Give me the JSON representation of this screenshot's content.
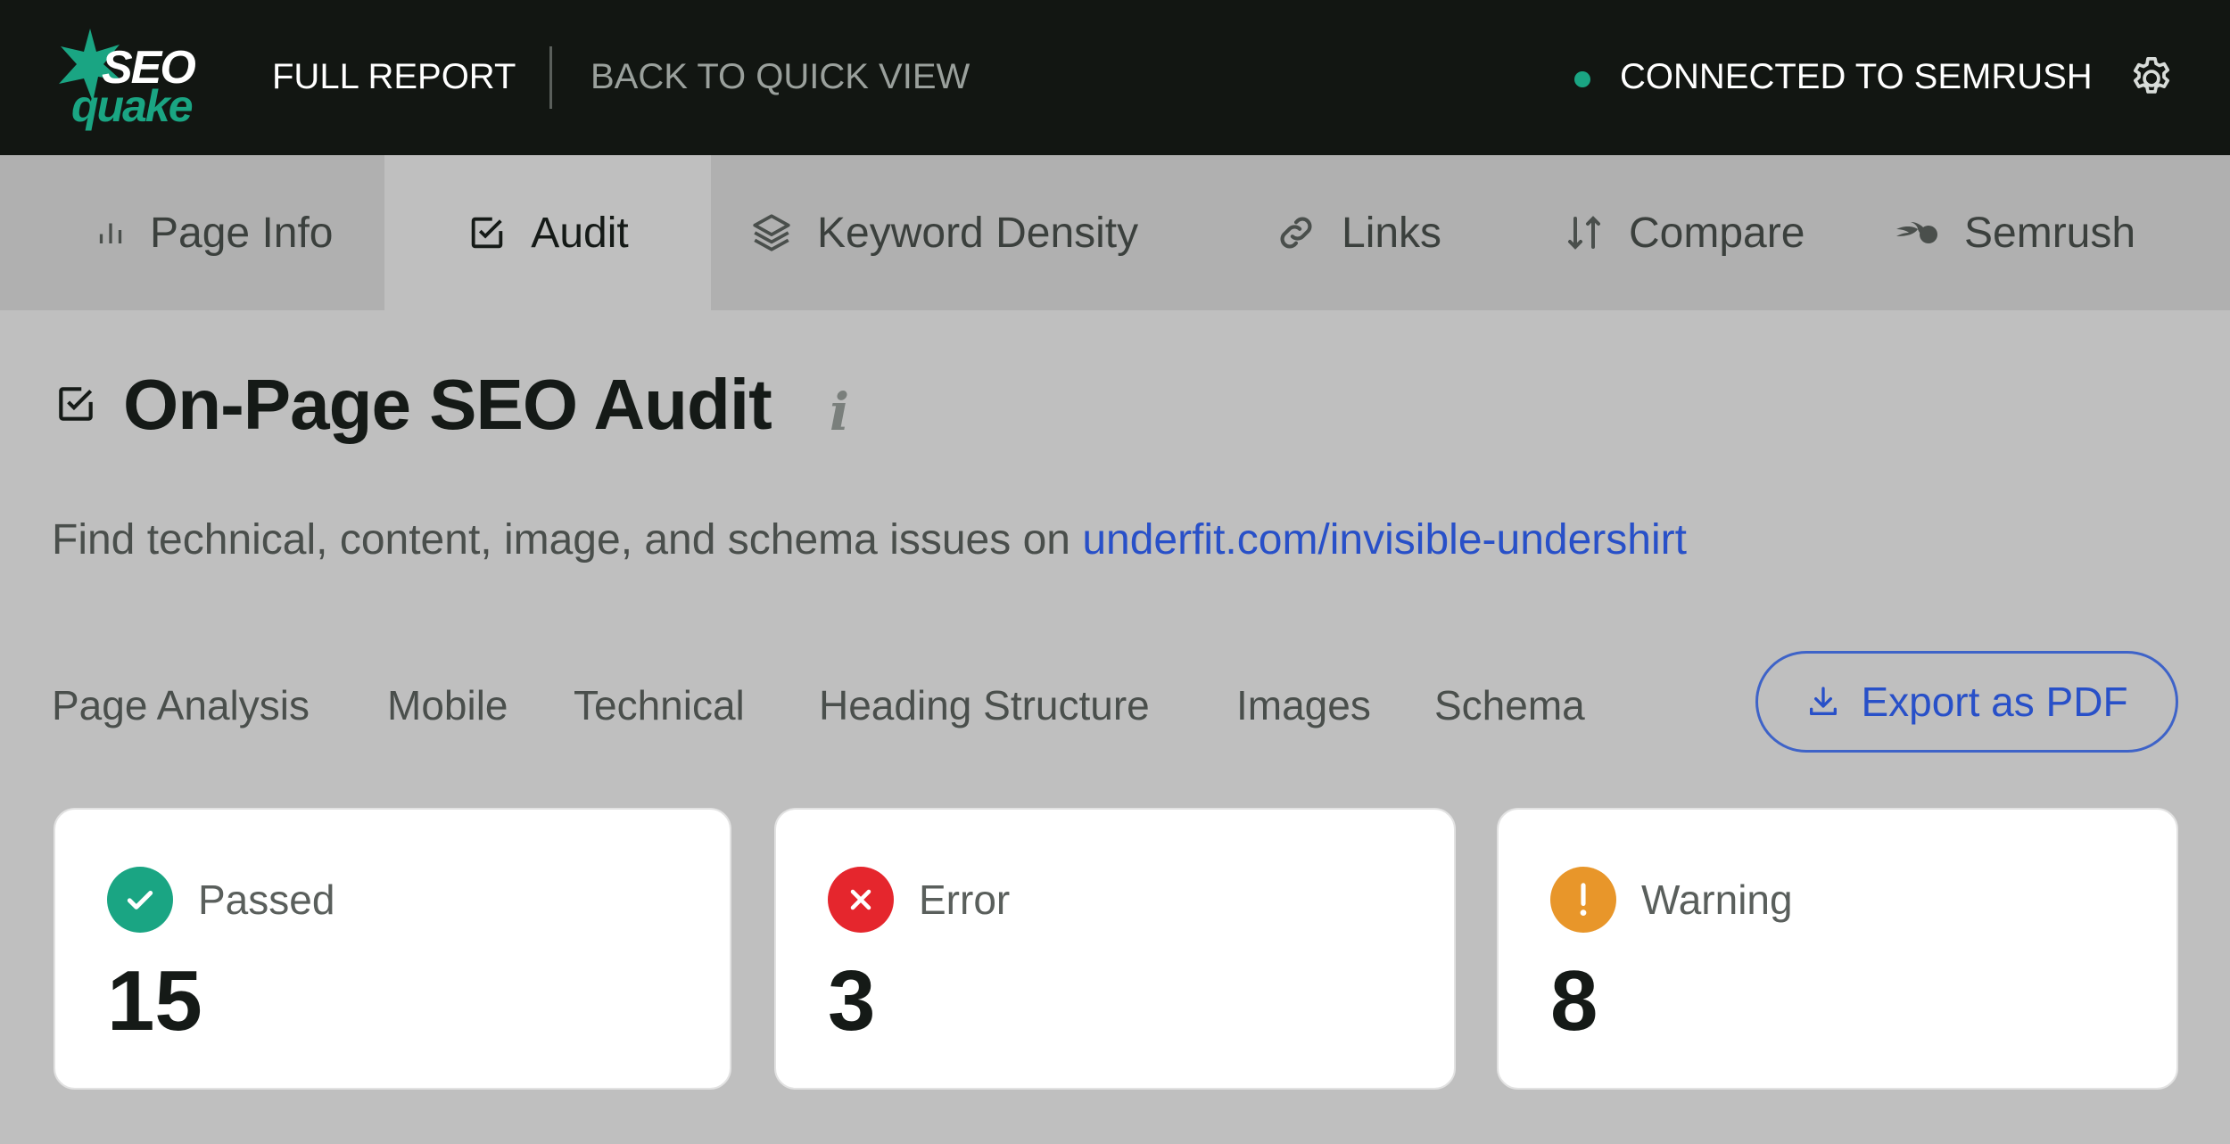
{
  "header": {
    "logo_top": "SEO",
    "logo_bottom": "quake",
    "full_report": "FULL REPORT",
    "back_quick_view": "BACK TO QUICK VIEW",
    "connection_status": "CONNECTED TO SEMRUSH"
  },
  "tabs": [
    {
      "label": "Page Info",
      "icon": "bar-chart-icon",
      "active": false
    },
    {
      "label": "Audit",
      "icon": "checkbox-icon",
      "active": true
    },
    {
      "label": "Keyword Density",
      "icon": "layers-icon",
      "active": false
    },
    {
      "label": "Links",
      "icon": "link-icon",
      "active": false
    },
    {
      "label": "Compare",
      "icon": "sort-arrows-icon",
      "active": false
    },
    {
      "label": "Semrush",
      "icon": "semrush-icon",
      "active": false
    }
  ],
  "audit": {
    "title": "On-Page SEO Audit",
    "info": "i",
    "description_prefix": "Find technical, content, image, and schema issues on ",
    "description_link": "underfit.com/invisible-undershirt"
  },
  "subnav": [
    "Page Analysis",
    "Mobile",
    "Technical",
    "Heading Structure",
    "Images",
    "Schema"
  ],
  "export_label": "Export as PDF",
  "cards": [
    {
      "label": "Passed",
      "count": "15",
      "color": "#1aa583"
    },
    {
      "label": "Error",
      "count": "3",
      "color": "#e5262d"
    },
    {
      "label": "Warning",
      "count": "8",
      "color": "#e8962a"
    }
  ],
  "colors": {
    "topbar": "#121612",
    "accent_green": "#1aa583",
    "link_blue": "#2850c8"
  }
}
